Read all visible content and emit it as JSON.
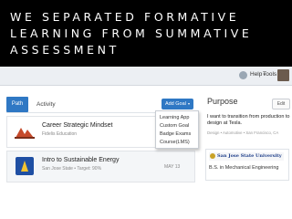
{
  "headline": {
    "lines": [
      "WE SEPARATED FORMATIVE",
      "LEARNING FROM SUMMATIVE",
      "ASSESSMENT"
    ]
  },
  "topbar": {
    "help_label": "Help",
    "tools_label": "Tools"
  },
  "tabs": {
    "path": "Path",
    "activity": "Activity"
  },
  "add_goal": {
    "label": "Add Goal",
    "menu": [
      "Learning App",
      "Custom Goal",
      "Badge Exams",
      "Course(LMS)"
    ]
  },
  "cards": [
    {
      "title": "Career Strategic Mindset",
      "subtitle": "Fidelis Education",
      "date": ""
    },
    {
      "title": "Intro to Sustainable Energy",
      "subtitle": "San Jose State • Target: 90%",
      "date": "MAY 13"
    }
  ],
  "purpose": {
    "heading": "Purpose",
    "edit_label": "Edit",
    "text": "I want to transition from production to design at Tesla.",
    "meta": "Design • Automotive • San Francisco, CA"
  },
  "degree": {
    "school": "San Jose State University",
    "name": "B.S. in Mechanical Engineering"
  },
  "colors": {
    "accent": "#2f78c4",
    "background": "#000000"
  }
}
